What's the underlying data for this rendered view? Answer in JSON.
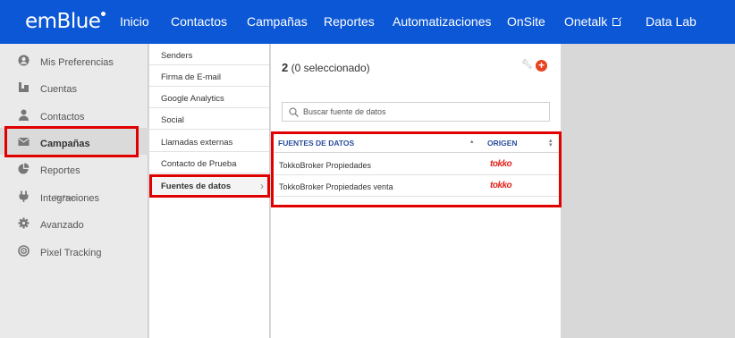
{
  "brand": {
    "logo": "emBlue"
  },
  "nav": {
    "items": [
      "Inicio",
      "Contactos",
      "Campañas",
      "Reportes",
      "Automatizaciones",
      "OnSite",
      "Onetalk",
      "Data Lab"
    ]
  },
  "sidebar": {
    "items": [
      {
        "label": "Mis Preferencias",
        "icon": "user-circle-icon"
      },
      {
        "label": "Cuentas",
        "icon": "accounts-icon"
      },
      {
        "label": "Contactos",
        "icon": "contact-icon"
      },
      {
        "label": "Campañas",
        "icon": "envelope-icon"
      },
      {
        "label": "Reportes",
        "icon": "pie-chart-icon"
      },
      {
        "label": "Integraciones",
        "icon": "plug-icon"
      },
      {
        "label": "Avanzado",
        "icon": "gear-icon"
      },
      {
        "label": "Pixel Tracking",
        "icon": "target-icon"
      }
    ],
    "flows_caption": "By Flows"
  },
  "submenu": {
    "items": [
      "Senders",
      "Firma de E-mail",
      "Google Analytics",
      "Social",
      "Llamadas externas",
      "Contacto de Prueba",
      "Fuentes de datos"
    ]
  },
  "main": {
    "count_number": "2",
    "count_text": "(0 seleccionado)",
    "search_placeholder": "Buscar fuente de datos",
    "table": {
      "col_source": "FUENTES DE DATOS",
      "col_origin": "ORIGEN",
      "rows": [
        {
          "name": "TokkoBroker Propiedades",
          "origin": "tokko"
        },
        {
          "name": "TokkoBroker Propiedades venta",
          "origin": "tokko"
        }
      ]
    }
  },
  "colors": {
    "nav_bg": "#0c57d6",
    "highlight": "#e00000",
    "accent_orange": "#e8431e",
    "header_blue": "#2c4d9c"
  }
}
